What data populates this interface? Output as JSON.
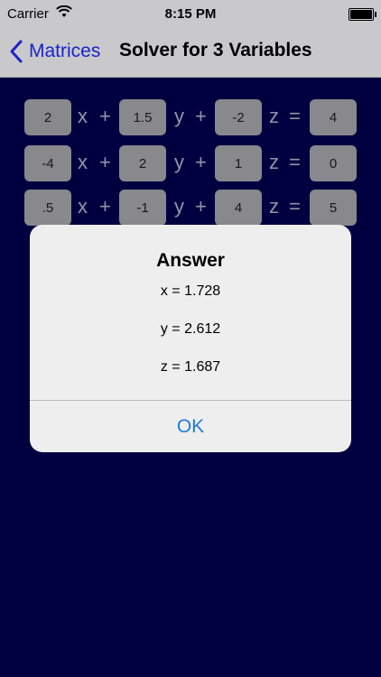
{
  "status": {
    "carrier": "Carrier",
    "time": "8:15 PM",
    "battery_level": 1.0
  },
  "nav": {
    "back_label": "Matrices",
    "title": "Solver for 3 Variables"
  },
  "equations": [
    {
      "a": "2",
      "b": "1.5",
      "c": "-2",
      "d": "4"
    },
    {
      "a": "-4",
      "b": "2",
      "c": "1",
      "d": "0"
    },
    {
      "a": ".5",
      "b": "-1",
      "c": "4",
      "d": "5"
    }
  ],
  "symbols": {
    "x": "x",
    "y": "y",
    "z": "z",
    "plus": "+",
    "equals": "="
  },
  "alert": {
    "title": "Answer",
    "lines": [
      "x = 1.728",
      "y = 2.612",
      "z = 1.687"
    ],
    "ok_label": "OK"
  },
  "colors": {
    "background": "#000050",
    "nav": "#c9c9cc",
    "accent": "#1b24c9",
    "ok": "#1f7bdc"
  }
}
